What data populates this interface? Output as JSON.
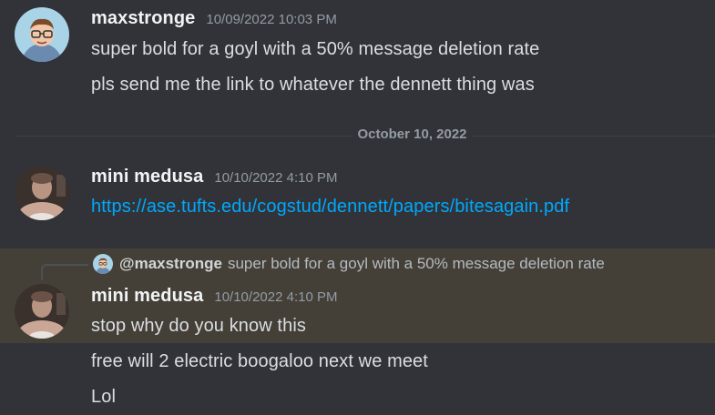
{
  "messages": {
    "group1": {
      "username": "maxstronge",
      "timestamp": "10/09/2022 10:03 PM",
      "line1": "super bold for a goyl with a 50% message deletion rate",
      "line2": "pls send me the link to whatever the dennett thing was"
    },
    "divider": {
      "label": "October 10, 2022"
    },
    "group2": {
      "username": "mini medusa",
      "timestamp": "10/10/2022 4:10 PM",
      "link": "https://ase.tufts.edu/cogstud/dennett/papers/bitesagain.pdf"
    },
    "group3": {
      "reply_username": "@maxstronge",
      "reply_text": "super bold for a goyl with a 50% message deletion rate",
      "username": "mini medusa",
      "timestamp": "10/10/2022 4:10 PM",
      "line1": "stop why do you know this",
      "line2": "free will 2 electric boogaloo next we meet",
      "line3": "Lol"
    }
  },
  "colors": {
    "background": "#313338",
    "highlight": "#444038",
    "link": "#00a8fc",
    "username": "#f2f3f5",
    "timestamp": "#949ba4"
  }
}
